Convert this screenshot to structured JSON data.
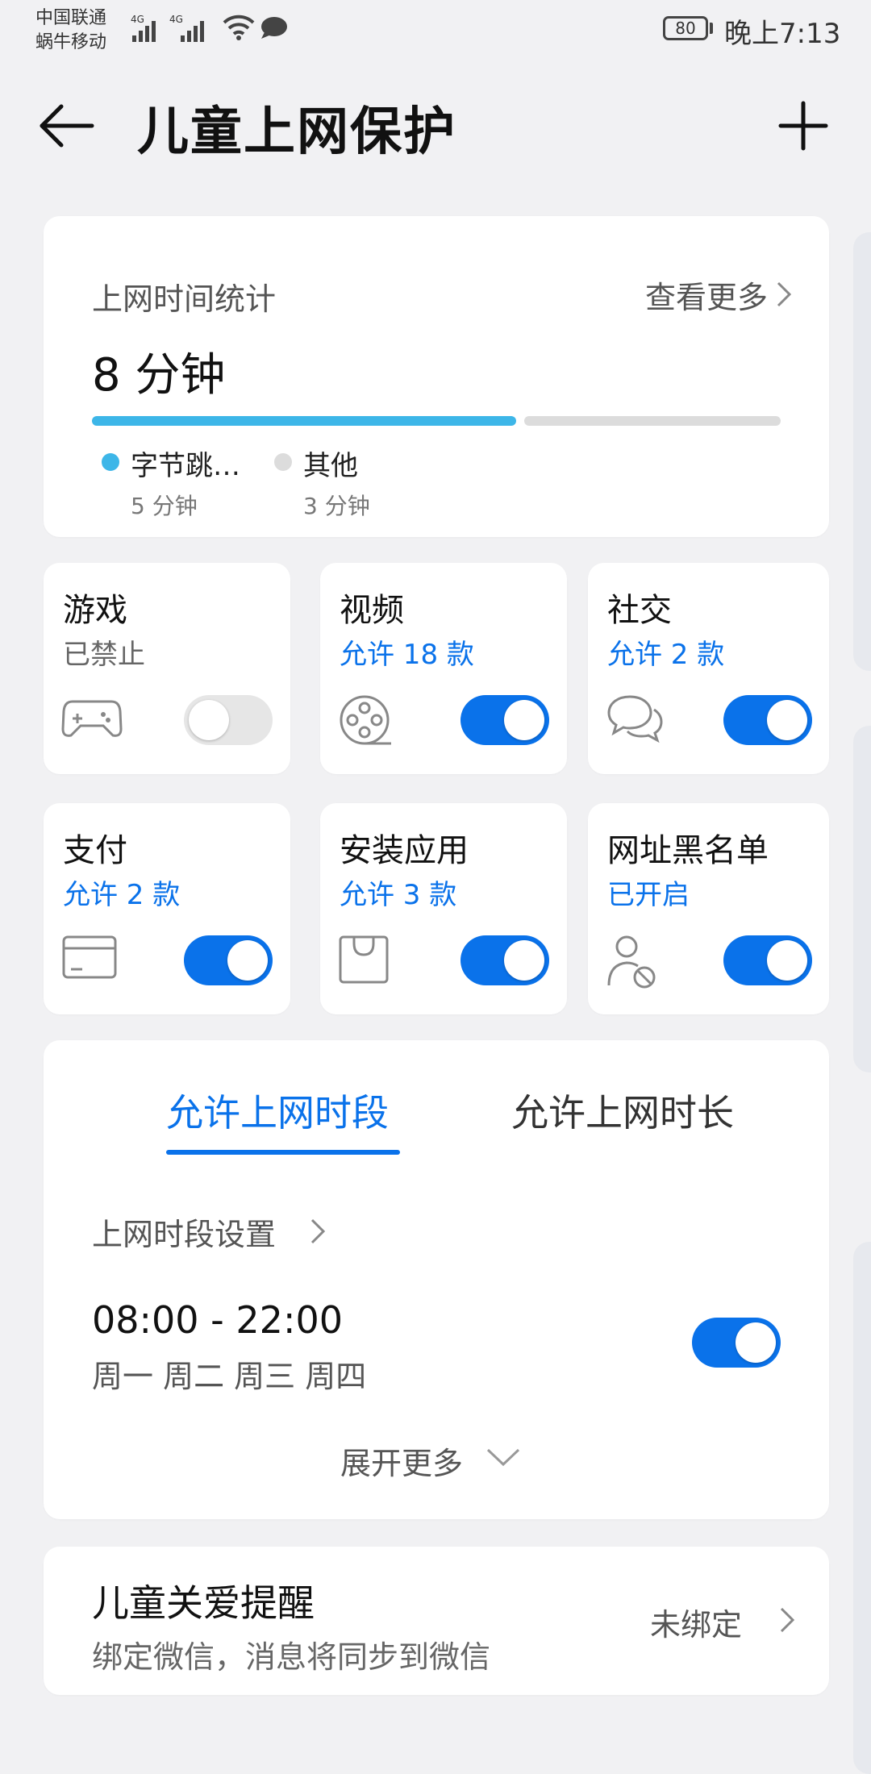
{
  "status_bar": {
    "carrier_1": "中国联通",
    "carrier_2": "蜗牛移动",
    "net_1": "4G",
    "net_2": "4G",
    "battery": "80",
    "time": "晚上7:13"
  },
  "header": {
    "title": "儿童上网保护",
    "back_icon": "arrow-left-icon",
    "add_icon": "plus-icon"
  },
  "usage": {
    "title": "上网时间统计",
    "more": "查看更多",
    "total": "8 分钟",
    "accent_color": "#3db6e8",
    "share_first_app": 0.62,
    "legend": [
      {
        "name": "字节跳…",
        "value": "5 分钟",
        "color": "#3db6e8"
      },
      {
        "name": "其他",
        "value": "3 分钟",
        "color": "#dcdcdc"
      }
    ]
  },
  "tiles": [
    {
      "title": "游戏",
      "status": "已禁止",
      "icon": "gamepad-icon",
      "enabled": false
    },
    {
      "title": "视频",
      "status": "允许 18 款",
      "icon": "film-reel-icon",
      "enabled": true
    },
    {
      "title": "社交",
      "status": "允许 2 款",
      "icon": "chat-bubbles-icon",
      "enabled": true
    },
    {
      "title": "支付",
      "status": "允许 2 款",
      "icon": "card-icon",
      "enabled": true
    },
    {
      "title": "安装应用",
      "status": "允许 3 款",
      "icon": "bag-icon",
      "enabled": true
    },
    {
      "title": "网址黑名单",
      "status": "已开启",
      "icon": "user-block-icon",
      "enabled": true
    }
  ],
  "time_control": {
    "tabs": [
      "允许上网时段",
      "允许上网时长"
    ],
    "active_tab": 0,
    "period_settings": "上网时段设置",
    "range": "08:00 - 22:00",
    "days": "周一 周二 周三 周四",
    "range_enabled": true,
    "expand": "展开更多"
  },
  "care": {
    "title": "儿童关爱提醒",
    "subtitle": "绑定微信，消息将同步到微信",
    "status": "未绑定"
  },
  "colors": {
    "accent": "#0a72ea",
    "background": "#f1f1f3"
  }
}
